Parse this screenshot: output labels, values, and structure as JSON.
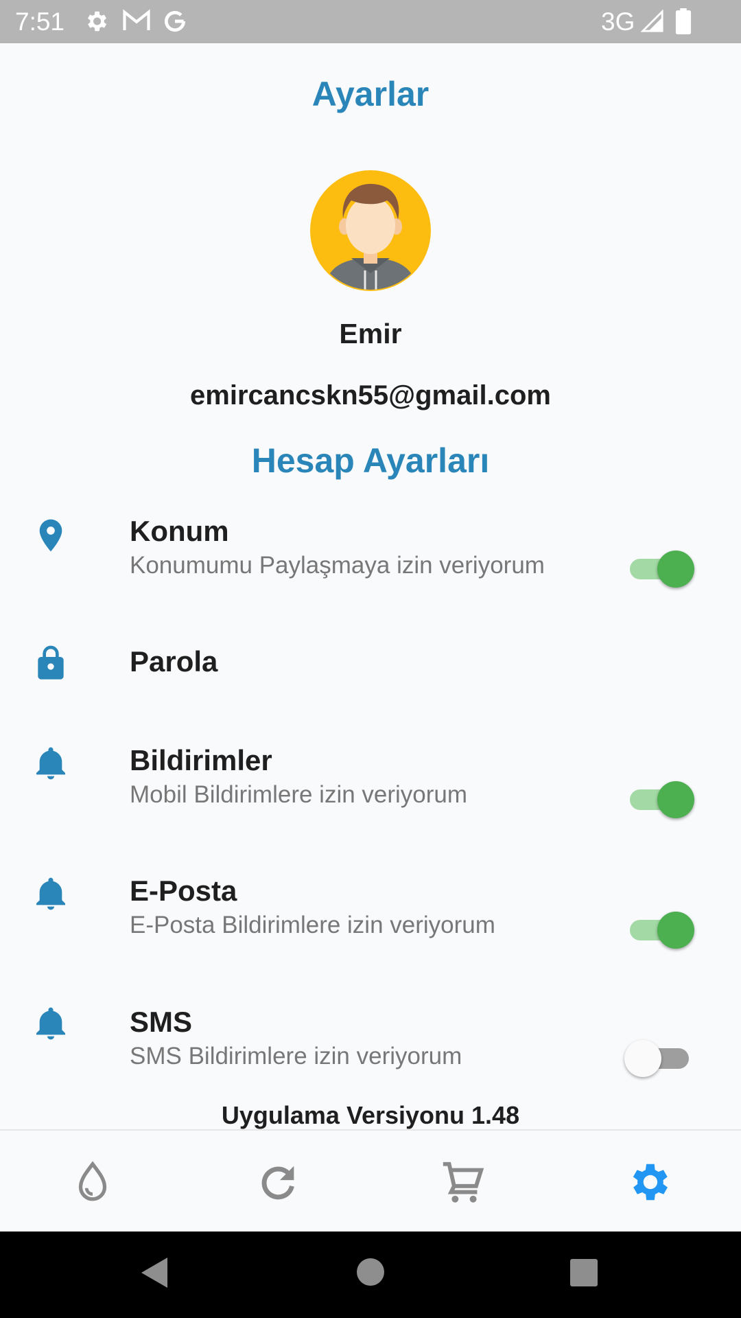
{
  "status_bar": {
    "time": "7:51",
    "network": "3G",
    "icons": [
      "settings-icon",
      "gmail-icon",
      "google-icon",
      "signal-icon",
      "battery-icon"
    ]
  },
  "header": {
    "title": "Ayarlar"
  },
  "profile": {
    "name": "Emir",
    "email": "emircancskn55@gmail.com",
    "avatar_bg": "#fdbd10"
  },
  "account_section": {
    "title": "Hesap Ayarları",
    "items": [
      {
        "icon": "location-pin-icon",
        "title": "Konum",
        "subtitle": "Konumumu Paylaşmaya izin veriyorum",
        "toggle": true
      },
      {
        "icon": "lock-icon",
        "title": "Parola",
        "subtitle": "",
        "toggle": null
      },
      {
        "icon": "bell-icon",
        "title": "Bildirimler",
        "subtitle": "Mobil Bildirimlere izin veriyorum",
        "toggle": true
      },
      {
        "icon": "bell-icon",
        "title": "E-Posta",
        "subtitle": "E-Posta Bildirimlere izin veriyorum",
        "toggle": true
      },
      {
        "icon": "bell-icon",
        "title": "SMS",
        "subtitle": "SMS Bildirimlere izin veriyorum",
        "toggle": false
      }
    ]
  },
  "footer": {
    "version": "Uygulama Versiyonu 1.48"
  },
  "bottom_nav": {
    "items": [
      "drop-icon",
      "refresh-icon",
      "cart-icon",
      "settings-icon"
    ],
    "active_index": 3,
    "active_color": "#2196f3",
    "inactive_color": "#8a8a8a"
  },
  "colors": {
    "accent": "#2a86b8",
    "toggle_on": "#4caf50"
  }
}
